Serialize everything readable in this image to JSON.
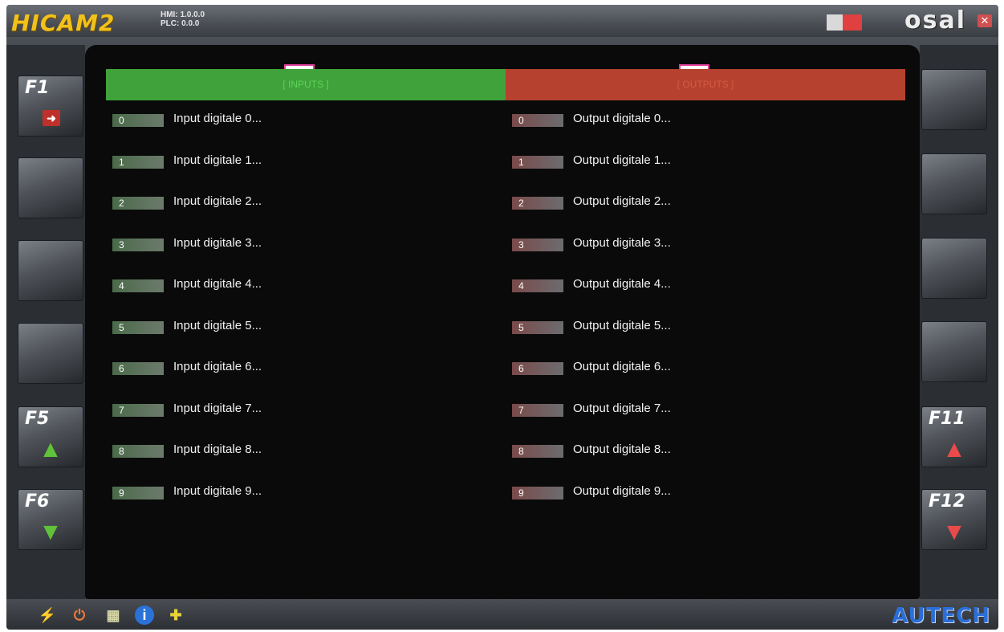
{
  "titlebar": {
    "app_logo": "HICAM2",
    "hmi_version": "HMI: 1.0.0.0",
    "plc_version": "PLC: 0.0.0",
    "brand": "osal",
    "close_icon": "close-icon"
  },
  "annotations": {
    "a": "a",
    "b": "b"
  },
  "left_buttons": [
    {
      "key": "F1",
      "icon": "exit-icon",
      "glyph": "➜"
    },
    {
      "key": "",
      "icon": ""
    },
    {
      "key": "",
      "icon": ""
    },
    {
      "key": "",
      "icon": ""
    },
    {
      "key": "F5",
      "icon": "arrow-up-icon",
      "glyph": "🡅"
    },
    {
      "key": "F6",
      "icon": "arrow-down-icon",
      "glyph": "🡇"
    }
  ],
  "right_buttons": [
    {
      "key": "",
      "icon": ""
    },
    {
      "key": "",
      "icon": ""
    },
    {
      "key": "",
      "icon": ""
    },
    {
      "key": "",
      "icon": ""
    },
    {
      "key": "F11",
      "icon": "arrow-up-icon",
      "glyph": "🡅"
    },
    {
      "key": "F12",
      "icon": "arrow-down-icon",
      "glyph": "🡇"
    }
  ],
  "inputs_header": "[ INPUTS ]",
  "outputs_header": "[ OUTPUTS ]",
  "inputs": [
    {
      "index": "0",
      "label": "Input digitale 0..."
    },
    {
      "index": "1",
      "label": "Input digitale 1..."
    },
    {
      "index": "2",
      "label": "Input digitale 2..."
    },
    {
      "index": "3",
      "label": "Input digitale 3..."
    },
    {
      "index": "4",
      "label": "Input digitale 4..."
    },
    {
      "index": "5",
      "label": "Input digitale 5..."
    },
    {
      "index": "6",
      "label": "Input digitale 6..."
    },
    {
      "index": "7",
      "label": "Input digitale 7..."
    },
    {
      "index": "8",
      "label": "Input digitale 8..."
    },
    {
      "index": "9",
      "label": "Input digitale 9..."
    }
  ],
  "outputs": [
    {
      "index": "0",
      "label": "Output digitale 0..."
    },
    {
      "index": "1",
      "label": "Output digitale 1..."
    },
    {
      "index": "2",
      "label": "Output digitale 2..."
    },
    {
      "index": "3",
      "label": "Output digitale 3..."
    },
    {
      "index": "4",
      "label": "Output digitale 4..."
    },
    {
      "index": "5",
      "label": "Output digitale 5..."
    },
    {
      "index": "6",
      "label": "Output digitale 6..."
    },
    {
      "index": "7",
      "label": "Output digitale 7..."
    },
    {
      "index": "8",
      "label": "Output digitale 8..."
    },
    {
      "index": "9",
      "label": "Output digitale 9..."
    }
  ],
  "bottombar": {
    "icons": [
      "power-plug-icon",
      "power-icon",
      "calculator-icon",
      "info-icon",
      "tools-icon"
    ],
    "brand": "AUTECH"
  },
  "colors": {
    "inputs_header": "#3fa23a",
    "outputs_header": "#b5412e",
    "logo": "#f2c21b",
    "autech": "#2a6ed8"
  }
}
